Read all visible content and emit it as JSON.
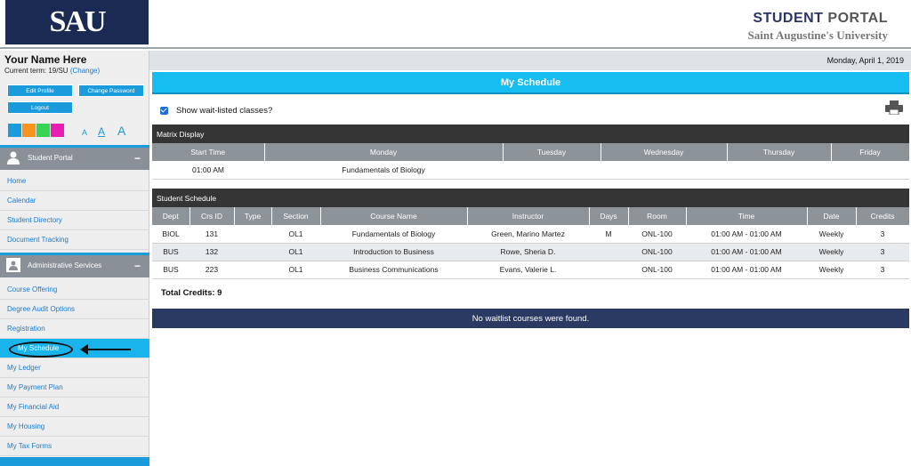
{
  "header": {
    "logo_text": "SAU",
    "portal_word1": "STUDENT",
    "portal_word2": "PORTAL",
    "university": "Saint Augustine's University"
  },
  "user": {
    "name": "Your Name Here",
    "term_label": "Current term: 19/SU",
    "change_label": "(Change)"
  },
  "sidebar_buttons": {
    "edit_profile": "Edit Profile",
    "change_password": "Change Password",
    "logout": "Logout"
  },
  "swatches": [
    "#1a9bdb",
    "#f7941d",
    "#39d353",
    "#e81eb4"
  ],
  "font_sizes": [
    "A",
    "A",
    "A"
  ],
  "sections": {
    "student_portal": {
      "title": "Student Portal",
      "items": [
        "Home",
        "Calendar",
        "Student Directory",
        "Document Tracking"
      ]
    },
    "admin_services": {
      "title": "Administrative Services",
      "items": [
        "Course Offering",
        "Degree Audit Options",
        "Registration",
        "My Schedule",
        "My Ledger",
        "My Payment Plan",
        "My Financial Aid",
        "My Housing",
        "My Tax Forms"
      ]
    }
  },
  "date": "Monday, April 1, 2019",
  "page_title": "My Schedule",
  "waitlist_label": "Show wait-listed classes?",
  "matrix": {
    "title": "Matrix Display",
    "headers": [
      "Start Time",
      "Monday",
      "Tuesday",
      "Wednesday",
      "Thursday",
      "Friday"
    ],
    "rows": [
      [
        "01:00 AM",
        "Fundamentals of Biology",
        "",
        "",
        "",
        ""
      ]
    ]
  },
  "schedule": {
    "title": "Student Schedule",
    "headers": [
      "Dept",
      "Crs ID",
      "Type",
      "Section",
      "Course Name",
      "Instructor",
      "Days",
      "Room",
      "Time",
      "Date",
      "Credits"
    ],
    "rows": [
      [
        "BIOL",
        "131",
        "",
        "OL1",
        "Fundamentals of Biology",
        "Green, Marino Martez",
        "M",
        "ONL-100",
        "01:00 AM - 01:00 AM",
        "Weekly",
        "3"
      ],
      [
        "BUS",
        "132",
        "",
        "OL1",
        "Introduction to Business",
        "Rowe, Sheria D.",
        "",
        "ONL-100",
        "01:00 AM - 01:00 AM",
        "Weekly",
        "3"
      ],
      [
        "BUS",
        "223",
        "",
        "OL1",
        "Business Communications",
        "Evans, Valerie L.",
        "",
        "ONL-100",
        "01:00 AM - 01:00 AM",
        "Weekly",
        "3"
      ]
    ]
  },
  "total_credits": "Total Credits: 9",
  "no_waitlist": "No waitlist courses were found."
}
